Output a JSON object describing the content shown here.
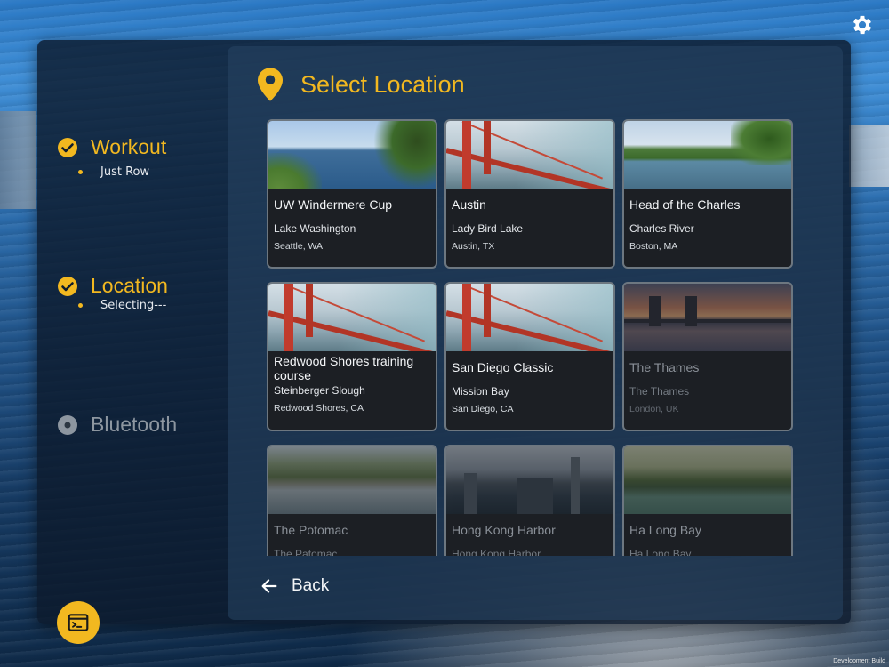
{
  "header": {
    "title": "Select Location"
  },
  "steps": [
    {
      "title": "Workout",
      "status": "done",
      "subtitle": "Just Row"
    },
    {
      "title": "Location",
      "status": "done",
      "subtitle": "Selecting---"
    },
    {
      "title": "Bluetooth",
      "status": "pending",
      "subtitle": ""
    }
  ],
  "locations": [
    {
      "name": "UW Windermere Cup",
      "water": "Lake Washington",
      "city": "Seattle, WA",
      "thumb": "lake"
    },
    {
      "name": "Austin",
      "water": "Lady Bird Lake",
      "city": "Austin, TX",
      "thumb": "bridge"
    },
    {
      "name": "Head of the Charles",
      "water": "Charles River",
      "city": "Boston, MA",
      "thumb": "charles"
    },
    {
      "name": "Redwood Shores training course",
      "water": "Steinberger Slough",
      "city": "Redwood Shores, CA",
      "thumb": "bridge"
    },
    {
      "name": "San Diego Classic",
      "water": "Mission Bay",
      "city": "San Diego, CA",
      "thumb": "bridge"
    },
    {
      "name": "The Thames",
      "water": "The Thames",
      "city": "London, UK",
      "thumb": "thames"
    },
    {
      "name": "The Potomac",
      "water": "The Patomac",
      "city": "",
      "thumb": "potomac"
    },
    {
      "name": "Hong Kong Harbor",
      "water": "Hong Kong Harbor",
      "city": "",
      "thumb": "hongkong"
    },
    {
      "name": "Ha Long Bay",
      "water": "Ha Long Bay",
      "city": "",
      "thumb": "halong"
    }
  ],
  "footer": {
    "back_label": "Back",
    "dev_label": "Development Build"
  },
  "colors": {
    "accent": "#f2b820",
    "card_bg": "#1c1f24",
    "panel": "#0c1a2c"
  },
  "icons": {
    "settings": "gear-icon",
    "step_done": "check-circle-icon",
    "step_pending": "radio-empty-icon",
    "header": "map-pin-icon",
    "back": "arrow-left-icon",
    "console": "terminal-icon"
  }
}
